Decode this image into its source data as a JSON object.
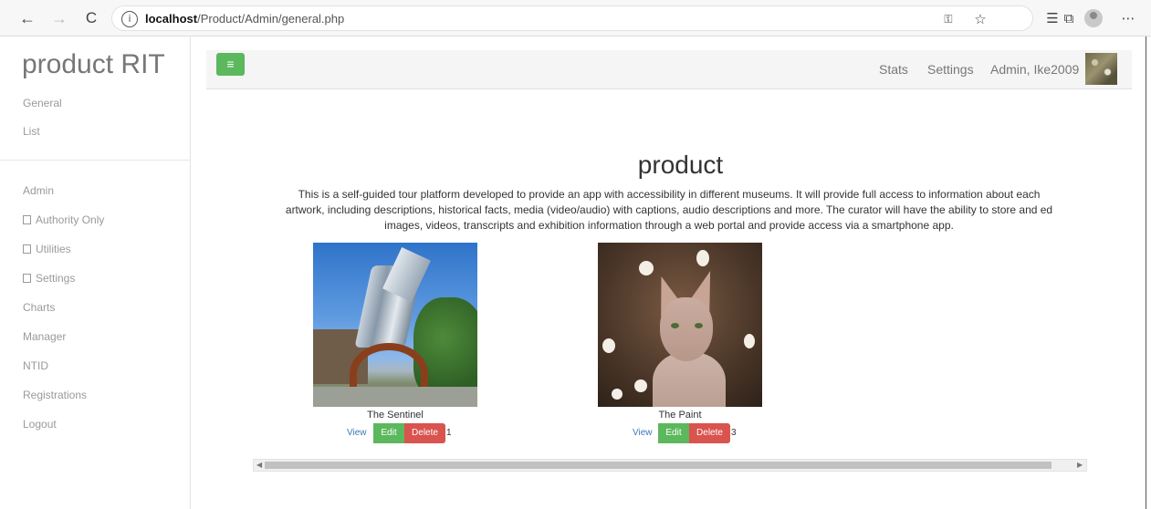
{
  "browser": {
    "back": "←",
    "forward": "→",
    "reload": "C",
    "info": "i",
    "url_host": "localhost",
    "url_path": "/Product/Admin/general.php"
  },
  "sidebar": {
    "brand": "product RIT",
    "items": [
      {
        "label": "General"
      },
      {
        "label": "List"
      },
      {
        "label": "Admin"
      },
      {
        "label": "Authority Only",
        "icon": "missing-glyph-box"
      },
      {
        "label": "Utilities",
        "icon": "missing-glyph-box"
      },
      {
        "label": "Settings",
        "icon": "missing-glyph-box"
      },
      {
        "label": "Charts"
      },
      {
        "label": "Manager"
      },
      {
        "label": "NTID"
      },
      {
        "label": "Registrations"
      },
      {
        "label": "Logout"
      }
    ]
  },
  "navbar": {
    "menu_icon": "≡",
    "links": [
      "Stats",
      "Settings",
      "Admin, Ike2009"
    ],
    "accent": "#5cb85c"
  },
  "main": {
    "title": "product",
    "description_lines": [
      "This is a self-guided tour platform developed to provide an app with accessibility in different museums. It will provide full access to information about each",
      "artwork, including descriptions, historical facts, media (video/audio) with captions, audio descriptions and more. The curator will have the ability to store and ed",
      "images, videos, transcripts and exhibition information through a web portal and provide access via a smartphone app."
    ],
    "cards": [
      {
        "name": "The Sentinel",
        "view": "View",
        "edit": "Edit",
        "delete": "Delete",
        "count": "1"
      },
      {
        "name": "The Paint",
        "view": "View",
        "edit": "Edit",
        "delete": "Delete",
        "count": "3"
      }
    ]
  },
  "colors": {
    "edit": "#5cb85c",
    "delete": "#d9534f",
    "link": "#3a78b5"
  }
}
